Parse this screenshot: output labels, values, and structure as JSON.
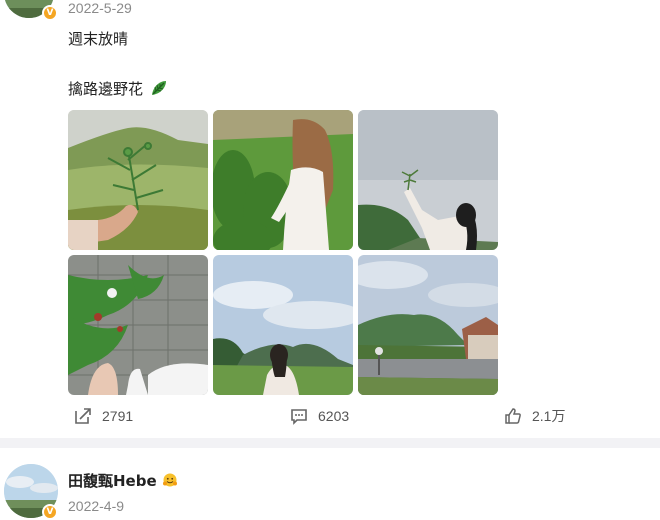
{
  "post1": {
    "date": "2022-5-29",
    "line1": "週末放晴",
    "line2": "擒路邊野花",
    "emoji_icon": "leaf-emoji-icon",
    "actions": {
      "repost_count": "2791",
      "comment_count": "6203",
      "like_count": "2.1万"
    }
  },
  "post2": {
    "author": "田馥甄Hebe",
    "date": "2022-4-9",
    "emoji_icon": "hugging-face-emoji-icon"
  },
  "colors": {
    "badge": "#f5a623",
    "background": "#f2f2f5",
    "card": "#ffffff"
  }
}
